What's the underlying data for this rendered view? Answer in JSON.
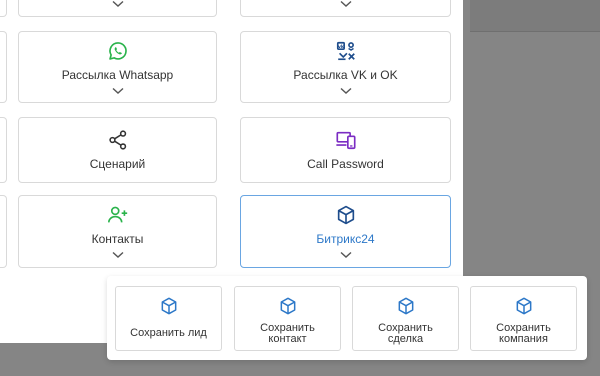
{
  "cards": {
    "whatsapp": {
      "label": "Рассылка Whatsapp",
      "icon": "whatsapp-icon"
    },
    "vk_ok": {
      "label": "Рассылка VK и OK",
      "icon": "vk-ok-icon"
    },
    "scenario": {
      "label": "Сценарий",
      "icon": "share-icon"
    },
    "call_password": {
      "label": "Call Password",
      "icon": "devices-icon"
    },
    "contacts": {
      "label": "Контакты",
      "icon": "add-user-icon"
    },
    "bitrix24": {
      "label": "Битрикс24",
      "icon": "box-icon"
    }
  },
  "popup": {
    "items": [
      {
        "label": "Сохранить лид"
      },
      {
        "label": "Сохранить\nконтакт"
      },
      {
        "label": "Сохранить\nсделка"
      },
      {
        "label": "Сохранить\nкомпания"
      }
    ]
  },
  "colors": {
    "green": "#2ab34b",
    "blue": "#2d78c8",
    "purple": "#7b2cc3",
    "navy": "#1e4d8c",
    "selected_border": "#6aa6e2"
  }
}
